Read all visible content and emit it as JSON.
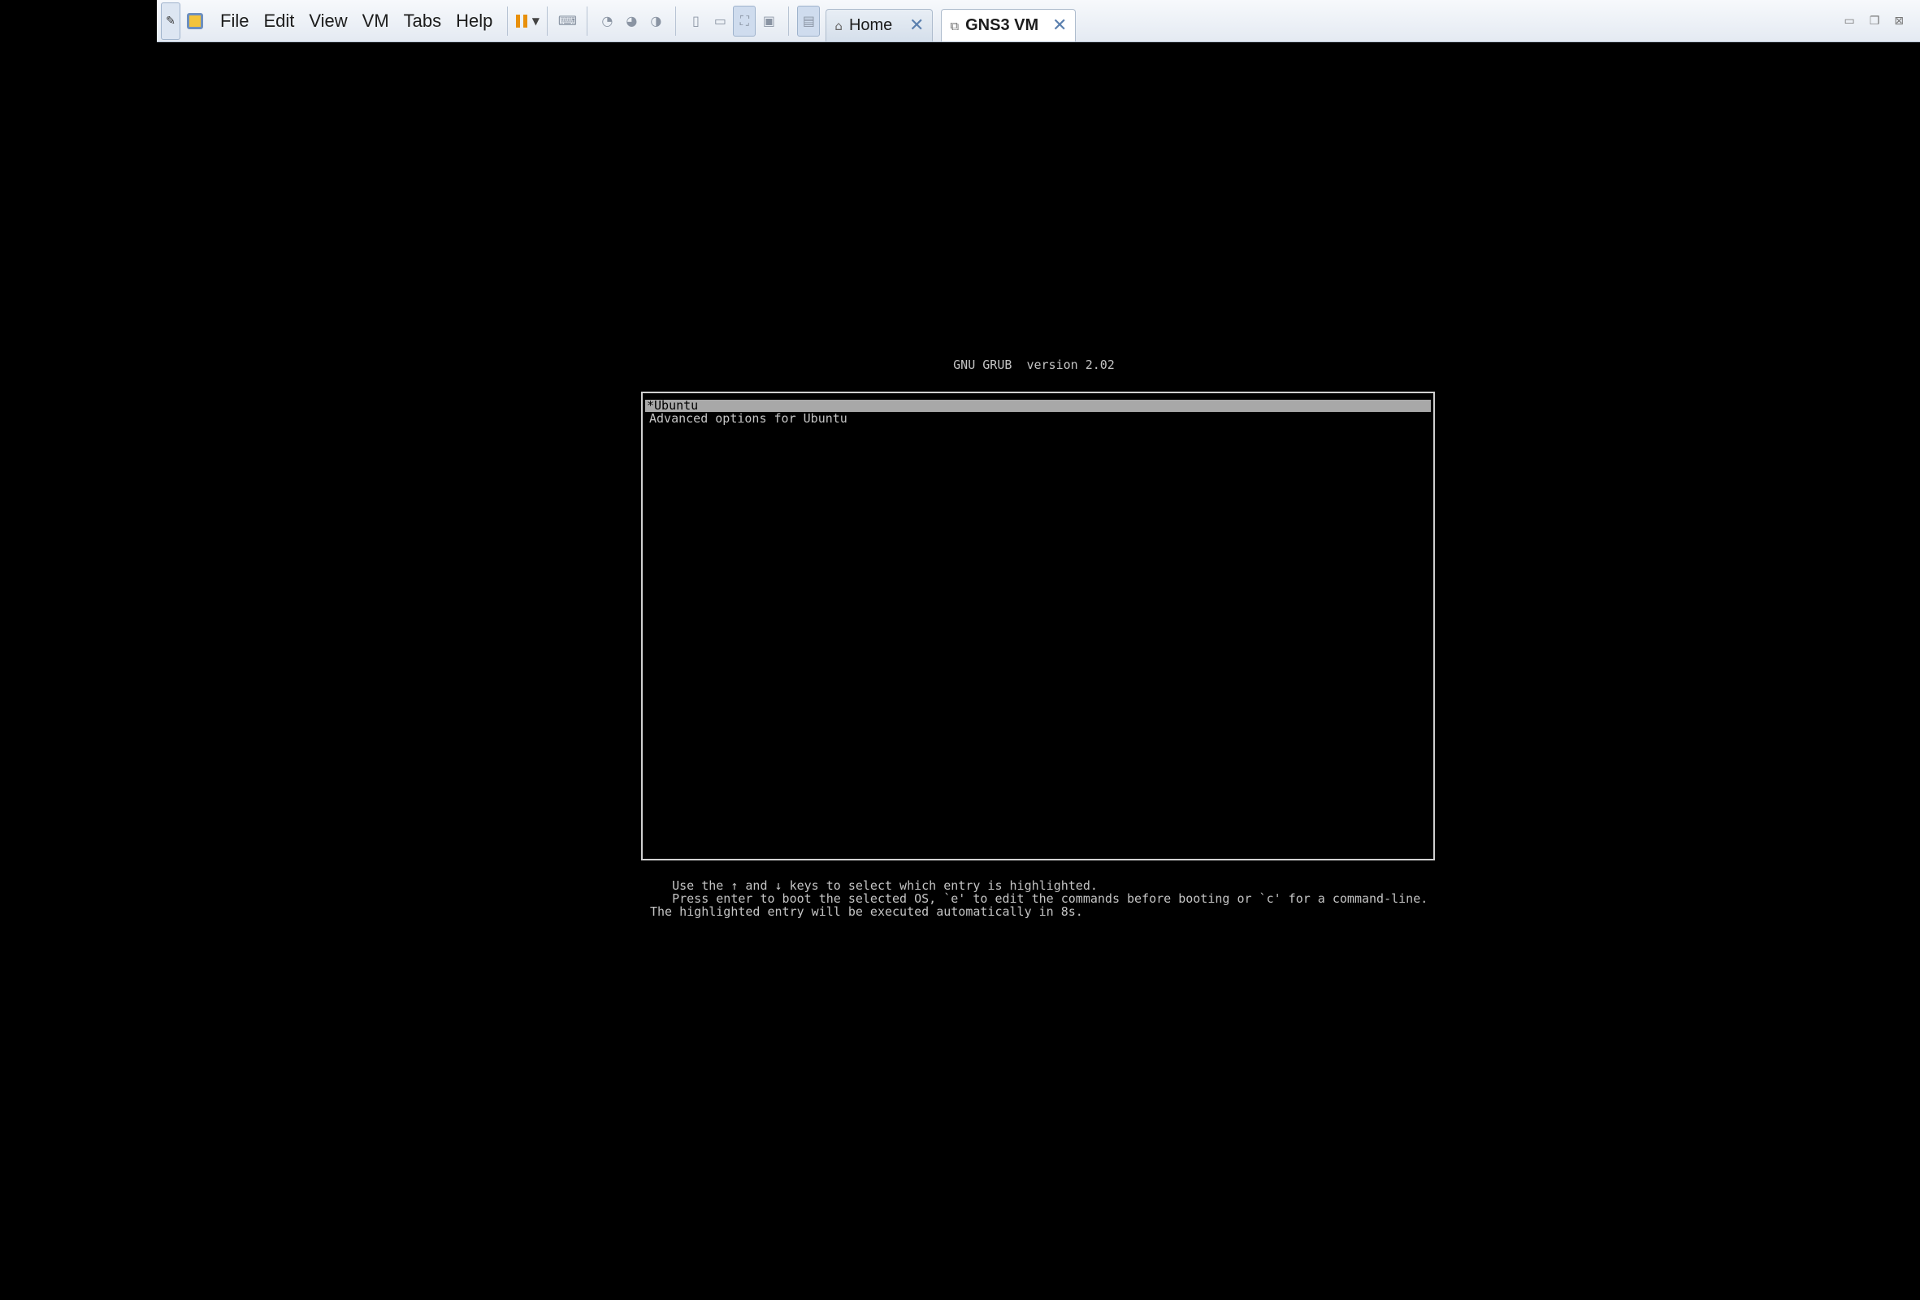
{
  "menu": {
    "items": [
      "File",
      "Edit",
      "View",
      "VM",
      "Tabs",
      "Help"
    ]
  },
  "tabs": [
    {
      "label": "Home",
      "icon": "home-icon"
    },
    {
      "label": "GNS3 VM",
      "icon": "vm-icon"
    }
  ],
  "grub": {
    "title": "GNU GRUB  version 2.02",
    "entries": [
      "*Ubuntu",
      "Advanced options for Ubuntu"
    ],
    "selected_index": 0,
    "help_lines": [
      "   Use the ↑ and ↓ keys to select which entry is highlighted.",
      "   Press enter to boot the selected OS, `e' to edit the commands before booting or `c' for a command-line.",
      "The highlighted entry will be executed automatically in 8s."
    ]
  },
  "colors": {
    "console_bg": "#000000",
    "console_text": "#c4c4c4",
    "selection_bg": "#a8a8a8",
    "pause_orange": "#e8900c",
    "tab_close_blue": "#5a7fae"
  }
}
